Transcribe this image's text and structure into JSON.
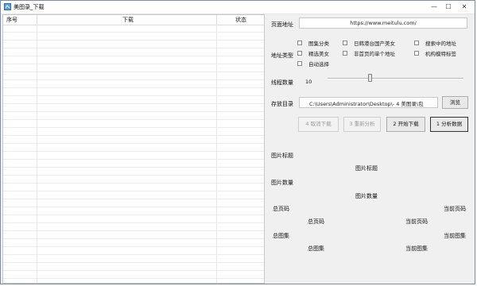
{
  "window": {
    "title": "美图录_下载",
    "minimize": "—",
    "maximize": "☐",
    "close": "✕"
  },
  "list": {
    "columns": [
      "序号",
      "下载",
      "状态"
    ]
  },
  "form": {
    "page_url_label": "页面地址",
    "page_url_value": "https://www.meitulu.com/",
    "addr_type_label": "地址类型",
    "checkboxes": [
      "图集分类",
      "日韩港台国产美女",
      "搜索中的地址",
      "精选美女",
      "非首页的单个地址",
      "机构模特标签",
      "自动选择"
    ],
    "threads_label": "线程数量",
    "threads_value": "10",
    "threads_slider_fraction": 0.31,
    "save_dir_label": "存放目录",
    "save_dir_value": "C:\\Users\\Administrator\\Desktop\\- 4 美图录\\包",
    "browse_button": "浏览",
    "buttons": [
      "4 取消下载",
      "3 重新分析",
      "2 开始下载",
      "1 分析数据"
    ]
  },
  "info": {
    "image_title_label": "图片标题",
    "image_title_value": "图片标题",
    "image_count_label": "图片数量",
    "image_count_value": "图片数量",
    "total_pages_label": "总页码",
    "current_page_label": "当前页码",
    "total_pages_value": "总页码",
    "current_page_value": "当前页码",
    "total_sets_label": "总图集",
    "current_set_label": "当前图集",
    "total_sets_value": "总图集",
    "current_set_value": "当前图集"
  }
}
